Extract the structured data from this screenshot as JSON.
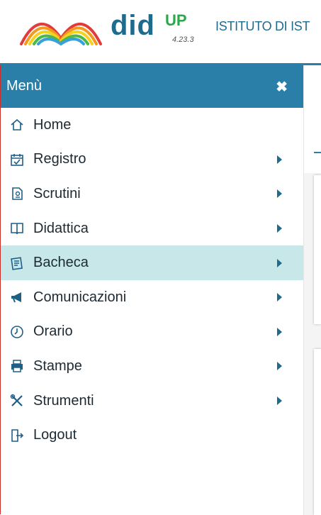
{
  "header": {
    "brand": "did",
    "brand_sup": "UP",
    "version": "4.23.3",
    "school_name": "ISTITUTO DI IST"
  },
  "sidebar": {
    "title": "Menù",
    "close_icon": "close-icon",
    "items": [
      {
        "label": "Home",
        "icon": "home-icon",
        "has_submenu": false
      },
      {
        "label": "Registro",
        "icon": "calendar-check-icon",
        "has_submenu": true
      },
      {
        "label": "Scrutini",
        "icon": "scrutini-icon",
        "has_submenu": true
      },
      {
        "label": "Didattica",
        "icon": "book-icon",
        "has_submenu": true
      },
      {
        "label": "Bacheca",
        "icon": "bulletin-icon",
        "has_submenu": true,
        "active": true
      },
      {
        "label": "Comunicazioni",
        "icon": "megaphone-icon",
        "has_submenu": true
      },
      {
        "label": "Orario",
        "icon": "clock-icon",
        "has_submenu": true
      },
      {
        "label": "Stampe",
        "icon": "printer-icon",
        "has_submenu": true
      },
      {
        "label": "Strumenti",
        "icon": "tools-icon",
        "has_submenu": true
      },
      {
        "label": "Logout",
        "icon": "logout-icon",
        "has_submenu": false
      }
    ]
  },
  "colors": {
    "accent": "#2a7fa8",
    "active_item_bg": "#c7e7e9",
    "brand_up": "#2aa84a"
  }
}
